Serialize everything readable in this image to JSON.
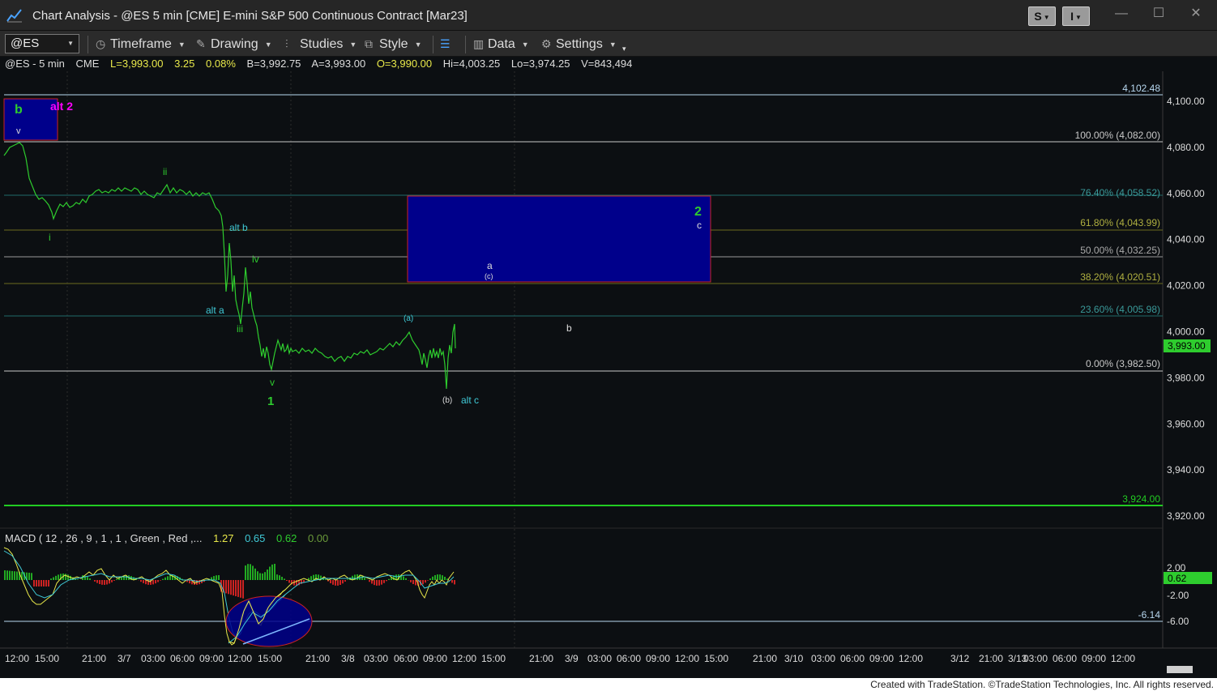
{
  "window": {
    "title": "Chart Analysis - @ES 5 min [CME] E-mini S&P 500 Continuous Contract [Mar23]",
    "btn_s": "S",
    "btn_i": "I",
    "minimize": "—",
    "maximize": "☐",
    "close": "✕"
  },
  "toolbar": {
    "symbol": "@ES",
    "timeframe": "Timeframe",
    "drawing": "Drawing",
    "studies": "Studies",
    "style": "Style",
    "data": "Data",
    "settings": "Settings"
  },
  "status": {
    "symbol": "@ES - 5 min",
    "exchange": "CME",
    "last": "L=3,993.00",
    "change": "3.25",
    "pct": "0.08%",
    "bid": "B=3,992.75",
    "ask": "A=3,993.00",
    "open": "O=3,990.00",
    "high": "Hi=4,003.25",
    "low": "Lo=3,974.25",
    "volume": "V=843,494"
  },
  "price_axis": [
    "4,100.00",
    "4,080.00",
    "4,060.00",
    "4,040.00",
    "4,020.00",
    "4,000.00",
    "3,980.00",
    "3,960.00",
    "3,940.00",
    "3,920.00"
  ],
  "current_price": "3,993.00",
  "levels": {
    "top": "4,102.48",
    "fib100": "100.00% (4,082.00)",
    "fib764": "76.40% (4,058.52)",
    "fib618": "61.80% (4,043.99)",
    "fib50": "50.00% (4,032.25)",
    "fib382": "38.20% (4,020.51)",
    "fib236": "23.60% (4,005.98)",
    "fib0": "0.00% (3,982.50)",
    "support": "3,924.00"
  },
  "wave_labels": {
    "b": "b",
    "v_top": "v",
    "alt2": "alt 2",
    "ii": "ii",
    "i": "i",
    "alt_b": "alt b",
    "iv": "iv",
    "alt_a": "alt a",
    "iii": "iii",
    "v": "v",
    "one": "1",
    "a_paren": "(a)",
    "b_paren": "(b)",
    "alt_c": "alt c",
    "a": "a",
    "c_paren": "(c)",
    "b_small": "b",
    "two": "2",
    "c": "c"
  },
  "macd": {
    "label": "MACD ( 12 , 26 , 9 , 1 , 1 , Green , Red ,...",
    "v1": "1.27",
    "v2": "0.65",
    "v3": "0.62",
    "v4": "0.00",
    "axis": [
      "2.00",
      "-2.00",
      "-6.00"
    ],
    "current": "0.62",
    "line_level": "-6.14"
  },
  "time_axis": [
    "12:00",
    "15:00",
    "21:00",
    "3/7",
    "03:00",
    "06:00",
    "09:00",
    "12:00",
    "15:00",
    "21:00",
    "3/8",
    "03:00",
    "06:00",
    "09:00",
    "12:00",
    "15:00",
    "21:00",
    "3/9",
    "03:00",
    "06:00",
    "09:00",
    "12:00",
    "15:00",
    "21:00",
    "3/10",
    "03:00",
    "06:00",
    "09:00",
    "12:00",
    "3/12",
    "21:00",
    "3/13",
    "03:00",
    "06:00",
    "09:00",
    "12:00"
  ],
  "footer": "Created with TradeStation. ©TradeStation Technologies, Inc. All rights reserved.",
  "colors": {
    "price": "#2ecc2e",
    "zone": "#00008b",
    "zone_border": "#cc2222",
    "magenta": "#ff00ff",
    "cyan_label": "#3fc9d6",
    "fib_text": "#3a9a9a",
    "fib_yellow": "#9a9a3a",
    "support": "#22cc22"
  }
}
